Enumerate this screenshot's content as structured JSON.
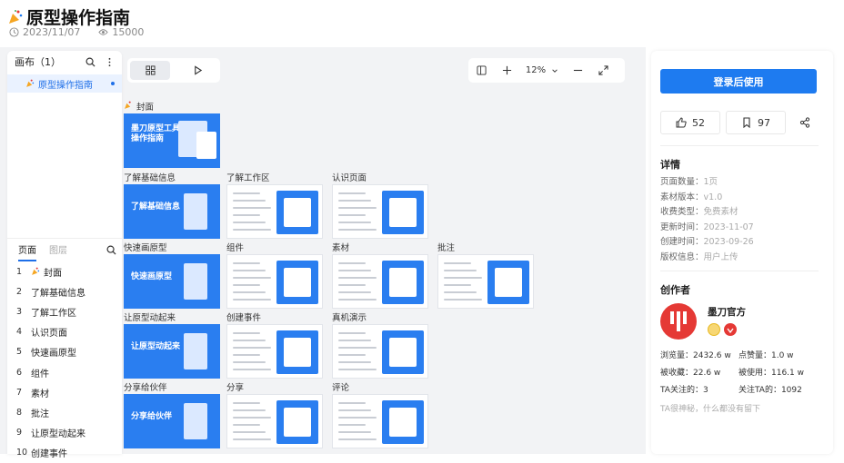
{
  "header": {
    "title": "原型操作指南",
    "date": "2023/11/07",
    "views": "15000"
  },
  "left_panel": {
    "canvas_title": "画布（1）",
    "canvas_item": "原型操作指南",
    "tab_pages": "页面",
    "tab_layers": "图层",
    "pages": [
      {
        "num": "1",
        "label": "封面",
        "emoji": true
      },
      {
        "num": "2",
        "label": "了解基础信息"
      },
      {
        "num": "3",
        "label": "了解工作区"
      },
      {
        "num": "4",
        "label": "认识页面"
      },
      {
        "num": "5",
        "label": "快速画原型"
      },
      {
        "num": "6",
        "label": "组件"
      },
      {
        "num": "7",
        "label": "素材"
      },
      {
        "num": "8",
        "label": "批注"
      },
      {
        "num": "9",
        "label": "让原型动起来"
      },
      {
        "num": "10",
        "label": "创建事件"
      }
    ]
  },
  "toolbar": {
    "zoom": "12%"
  },
  "thumbnails": {
    "cover_label": "封面",
    "cover_title": "墨刀原型工具\n操作指南",
    "labels": [
      "了解基础信息",
      "了解工作区",
      "认识页面",
      "快速画原型",
      "组件",
      "素材",
      "批注",
      "让原型动起来",
      "创建事件",
      "真机演示",
      "分享给伙伴",
      "分享",
      "评论"
    ],
    "blue_titles": [
      "了解基础信息",
      "快速画原型",
      "让原型动起来",
      "分享给伙伴"
    ]
  },
  "right_panel": {
    "login_button": "登录后使用",
    "likes": "52",
    "favorites": "97",
    "details_title": "详情",
    "details": [
      {
        "k": "页面数量：",
        "v": "1页"
      },
      {
        "k": "素材版本：",
        "v": "v1.0"
      },
      {
        "k": "收费类型：",
        "v": "免费素材"
      },
      {
        "k": "更新时间：",
        "v": "2023-11-07"
      },
      {
        "k": "创建时间：",
        "v": "2023-09-26"
      },
      {
        "k": "版权信息：",
        "v": "用户上传"
      }
    ],
    "author_title": "创作者",
    "author_name": "墨刀官方",
    "stats": {
      "views": "浏览量：2432.6 w",
      "likes": "点赞量：1.0 w",
      "favorited": "被收藏：22.6 w",
      "used": "被使用：116.1 w",
      "following": "TA关注的：3",
      "followers": "关注TA的：1092"
    },
    "note": "TA很神秘，什么都没有留下"
  },
  "colors": {
    "accent": "#1e7bf0",
    "thumb_blue": "#2a7ef0"
  }
}
